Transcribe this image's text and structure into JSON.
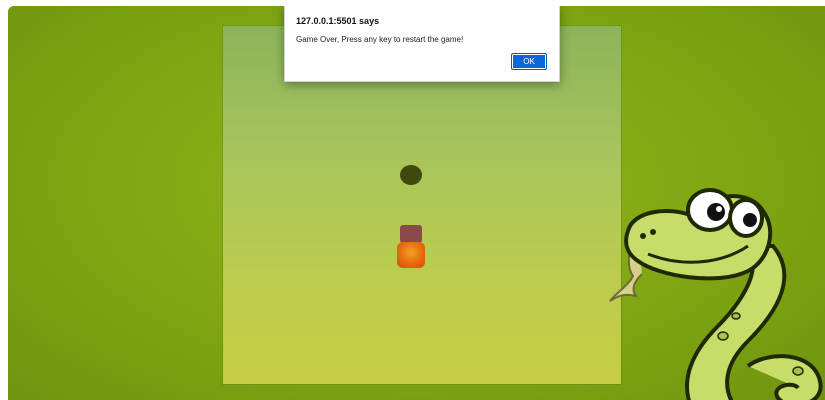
{
  "dialog": {
    "title": "127.0.0.1:5501 says",
    "message": "Game Over, Press any key to restart the game!",
    "ok_label": "OK"
  },
  "game": {
    "food_icon": "food-dot",
    "snake_segments": 2
  },
  "colors": {
    "background": "#80a612",
    "board_top": "#8bb45a",
    "board_bottom": "#c6cd45",
    "food": "#3f4a0c",
    "snake_body": "#8a4a4a",
    "snake_head": "#e86a10",
    "ok_button": "#0a68d6"
  }
}
